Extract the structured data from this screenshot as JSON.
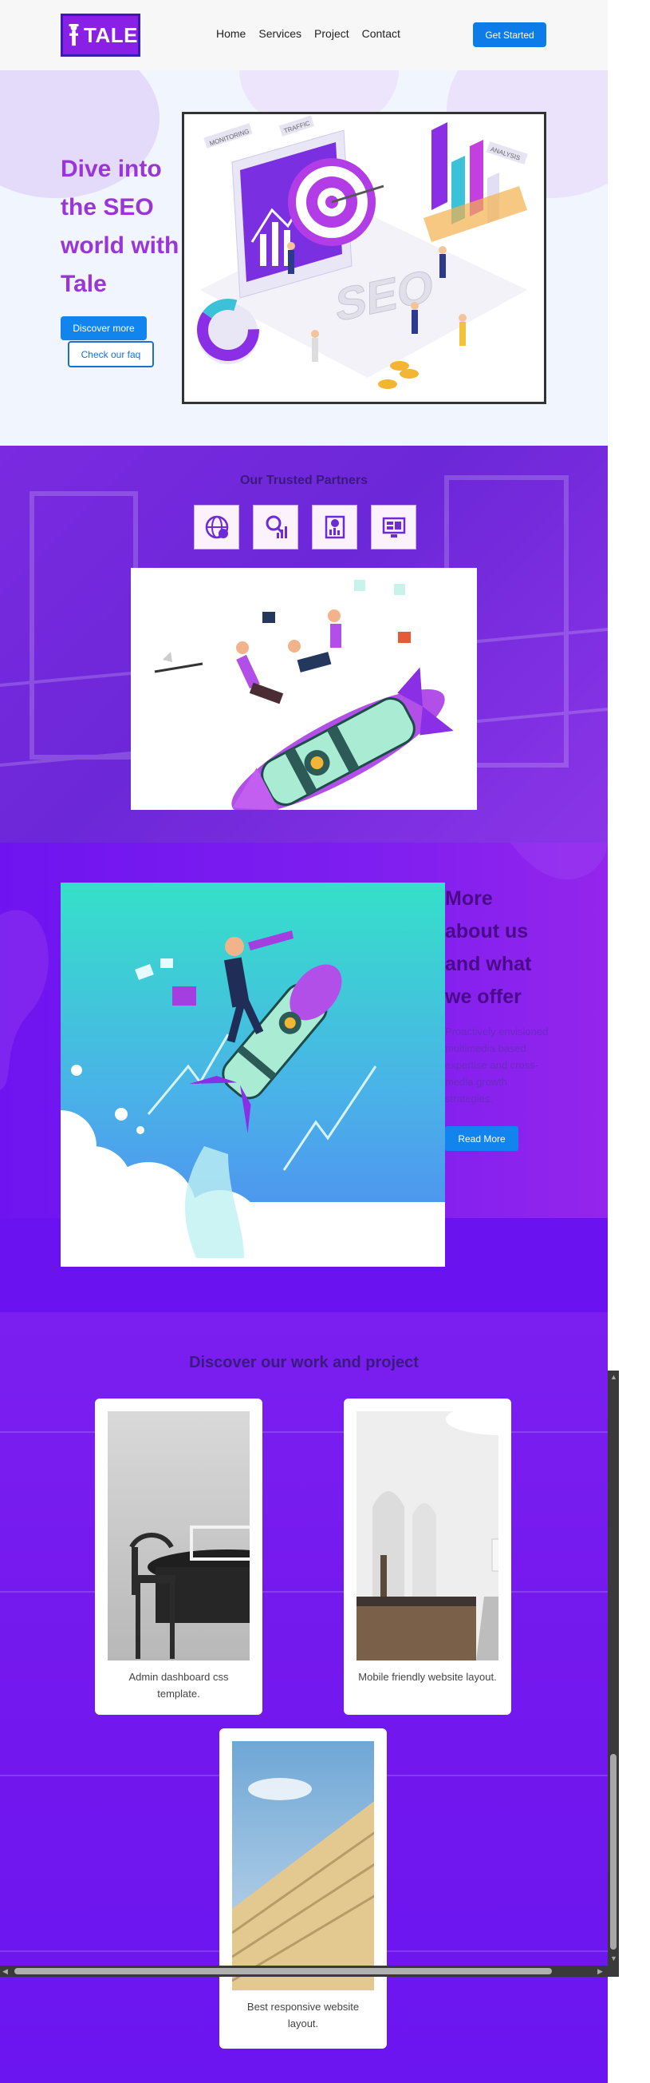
{
  "nav": {
    "logo_text": "TALE",
    "links": [
      "Home",
      "Services",
      "Project",
      "Contact"
    ],
    "cta": "Get Started"
  },
  "hero": {
    "title": "Dive into the SEO world with Tale",
    "discover": "Discover more",
    "faq": "Check our faq",
    "illustration_labels": [
      "MONITORING",
      "TRAFFIC",
      "ANALYSIS",
      "SEO"
    ]
  },
  "partners": {
    "title": "Our Trusted Partners",
    "icons": [
      "globe-dollar-icon",
      "analytics-magnifier-icon",
      "report-chart-icon",
      "monitor-dashboard-icon"
    ]
  },
  "about": {
    "title": "More about us and what we offer",
    "text": "Proactively envisioned multimedia based expertise and cross-media growth strategies.",
    "button": "Read More"
  },
  "work": {
    "title": "Discover our work and project",
    "cards": [
      {
        "caption": "Admin dashboard css template."
      },
      {
        "caption": "Mobile friendly website layout."
      },
      {
        "caption": "Best responsive website layout."
      }
    ]
  },
  "colors": {
    "primary_button": "#1284ee",
    "logo_bg": "#8a1fe6",
    "hero_title": "#9a36d6",
    "section_purple": "#6a12ef"
  }
}
